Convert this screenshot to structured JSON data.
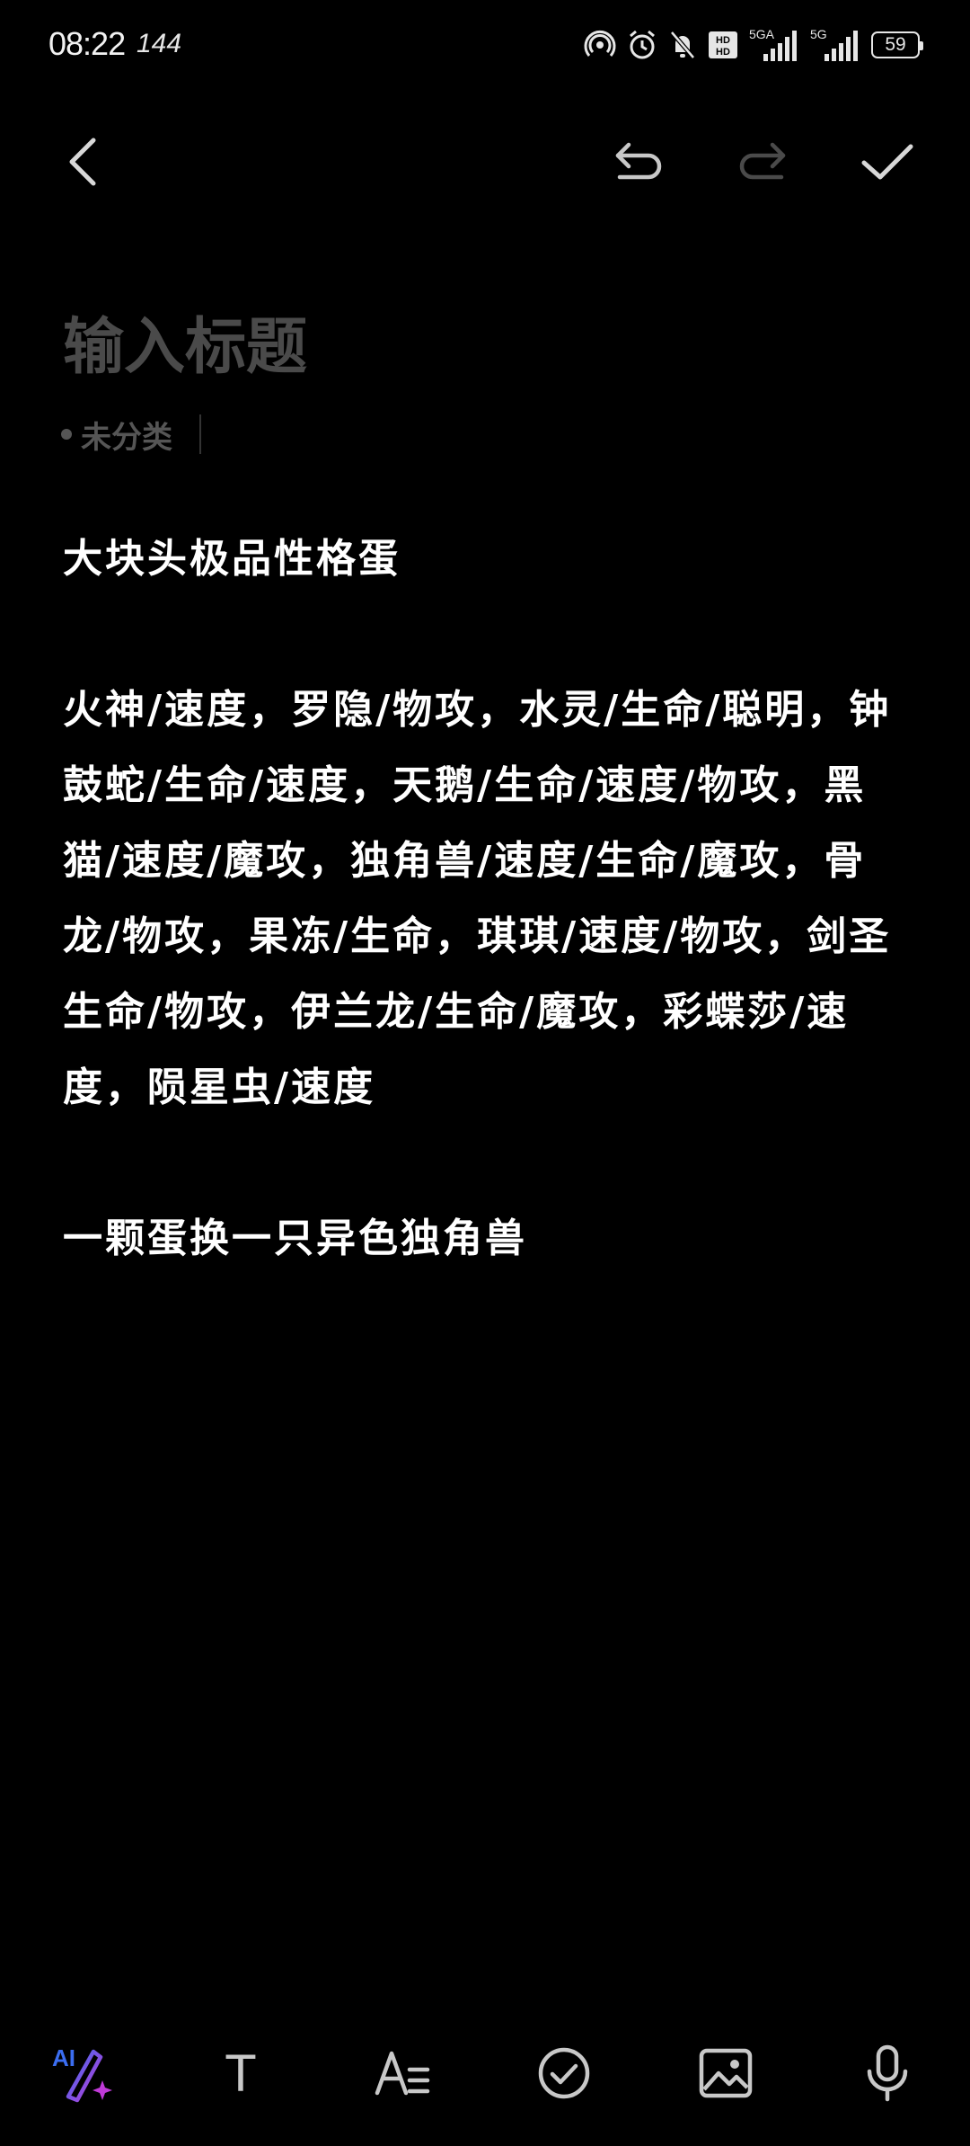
{
  "status_bar": {
    "time": "08:22",
    "refresh_rate": "144",
    "network_primary": "5GA",
    "network_secondary": "5G",
    "battery": "59"
  },
  "toolbar": {
    "back": "chevron-left-icon",
    "undo": "undo-icon",
    "redo": "redo-icon",
    "done": "check-icon"
  },
  "note": {
    "title_placeholder": "输入标题",
    "category": "未分类",
    "paragraphs": [
      "大块头极品性格蛋",
      "火神/速度，罗隐/物攻，水灵/生命/聪明，钟鼓蛇/生命/速度，天鹅/生命/速度/物攻，黑猫/速度/魔攻，独角兽/速度/生命/魔攻，骨龙/物攻，果冻/生命，琪琪/速度/物攻，剑圣生命/物攻，伊兰龙/生命/魔攻，彩蝶莎/速度，陨星虫/速度",
      "一颗蛋换一只异色独角兽"
    ]
  },
  "bottom_toolbar": {
    "ai_label": "AI",
    "text_label": "T",
    "tools": [
      "ai-write-icon",
      "text-style-icon",
      "format-list-icon",
      "checklist-icon",
      "image-icon",
      "microphone-icon"
    ]
  },
  "colors": {
    "background": "#000000",
    "text": "#ffffff",
    "placeholder": "#4a4a4a",
    "icon": "#c8c8c8",
    "icon_disabled": "#4a4a4a",
    "ai_gradient_start": "#3b6df0",
    "ai_gradient_end": "#c03ad8"
  }
}
